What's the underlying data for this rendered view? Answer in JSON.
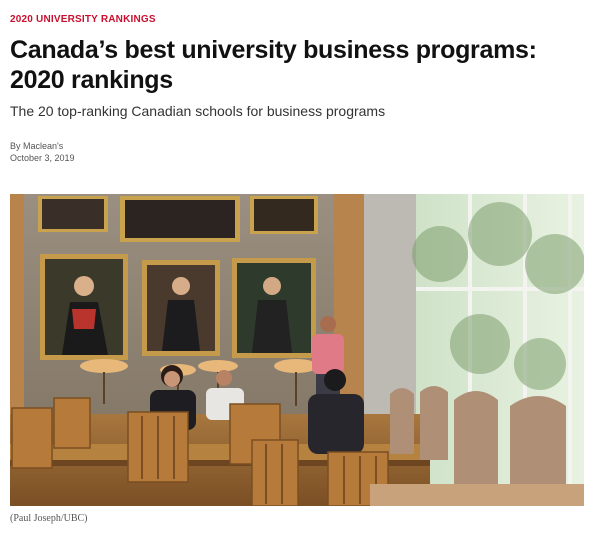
{
  "article": {
    "kicker": "2020 UNIVERSITY RANKINGS",
    "headline": "Canada’s best university business programs: 2020 rankings",
    "dek": "The 20 top-ranking Canadian schools for business programs",
    "byline_prefix": "By ",
    "author": "Maclean's",
    "date": "October 3, 2019",
    "photo_caption": "(Paul Joseph/UBC)"
  },
  "colors": {
    "kicker": "#c8102e"
  }
}
